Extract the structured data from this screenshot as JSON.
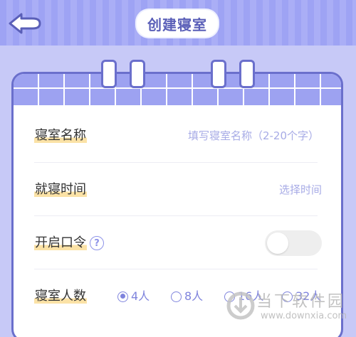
{
  "header": {
    "title": "创建寝室",
    "back_icon": "back-arrow-icon"
  },
  "form": {
    "name_label": "寝室名称",
    "name_placeholder": "填写寝室名称（2-20个字）",
    "bedtime_label": "就寝时间",
    "bedtime_value": "选择时间",
    "password_label": "开启口令",
    "help_icon_text": "?",
    "password_toggle_on": false,
    "size_label": "寝室人数",
    "size_options": [
      {
        "label": "4人",
        "selected": true
      },
      {
        "label": "8人",
        "selected": false
      },
      {
        "label": "16人",
        "selected": false
      },
      {
        "label": "32人",
        "selected": false
      }
    ]
  },
  "watermark": {
    "name": "当下软件园",
    "url": "www.downxia.com"
  },
  "colors": {
    "header_bg": "#9ea3f4",
    "accent": "#6a6fcc",
    "label_highlight": "#fbe2a6",
    "placeholder": "#a7abe6"
  }
}
